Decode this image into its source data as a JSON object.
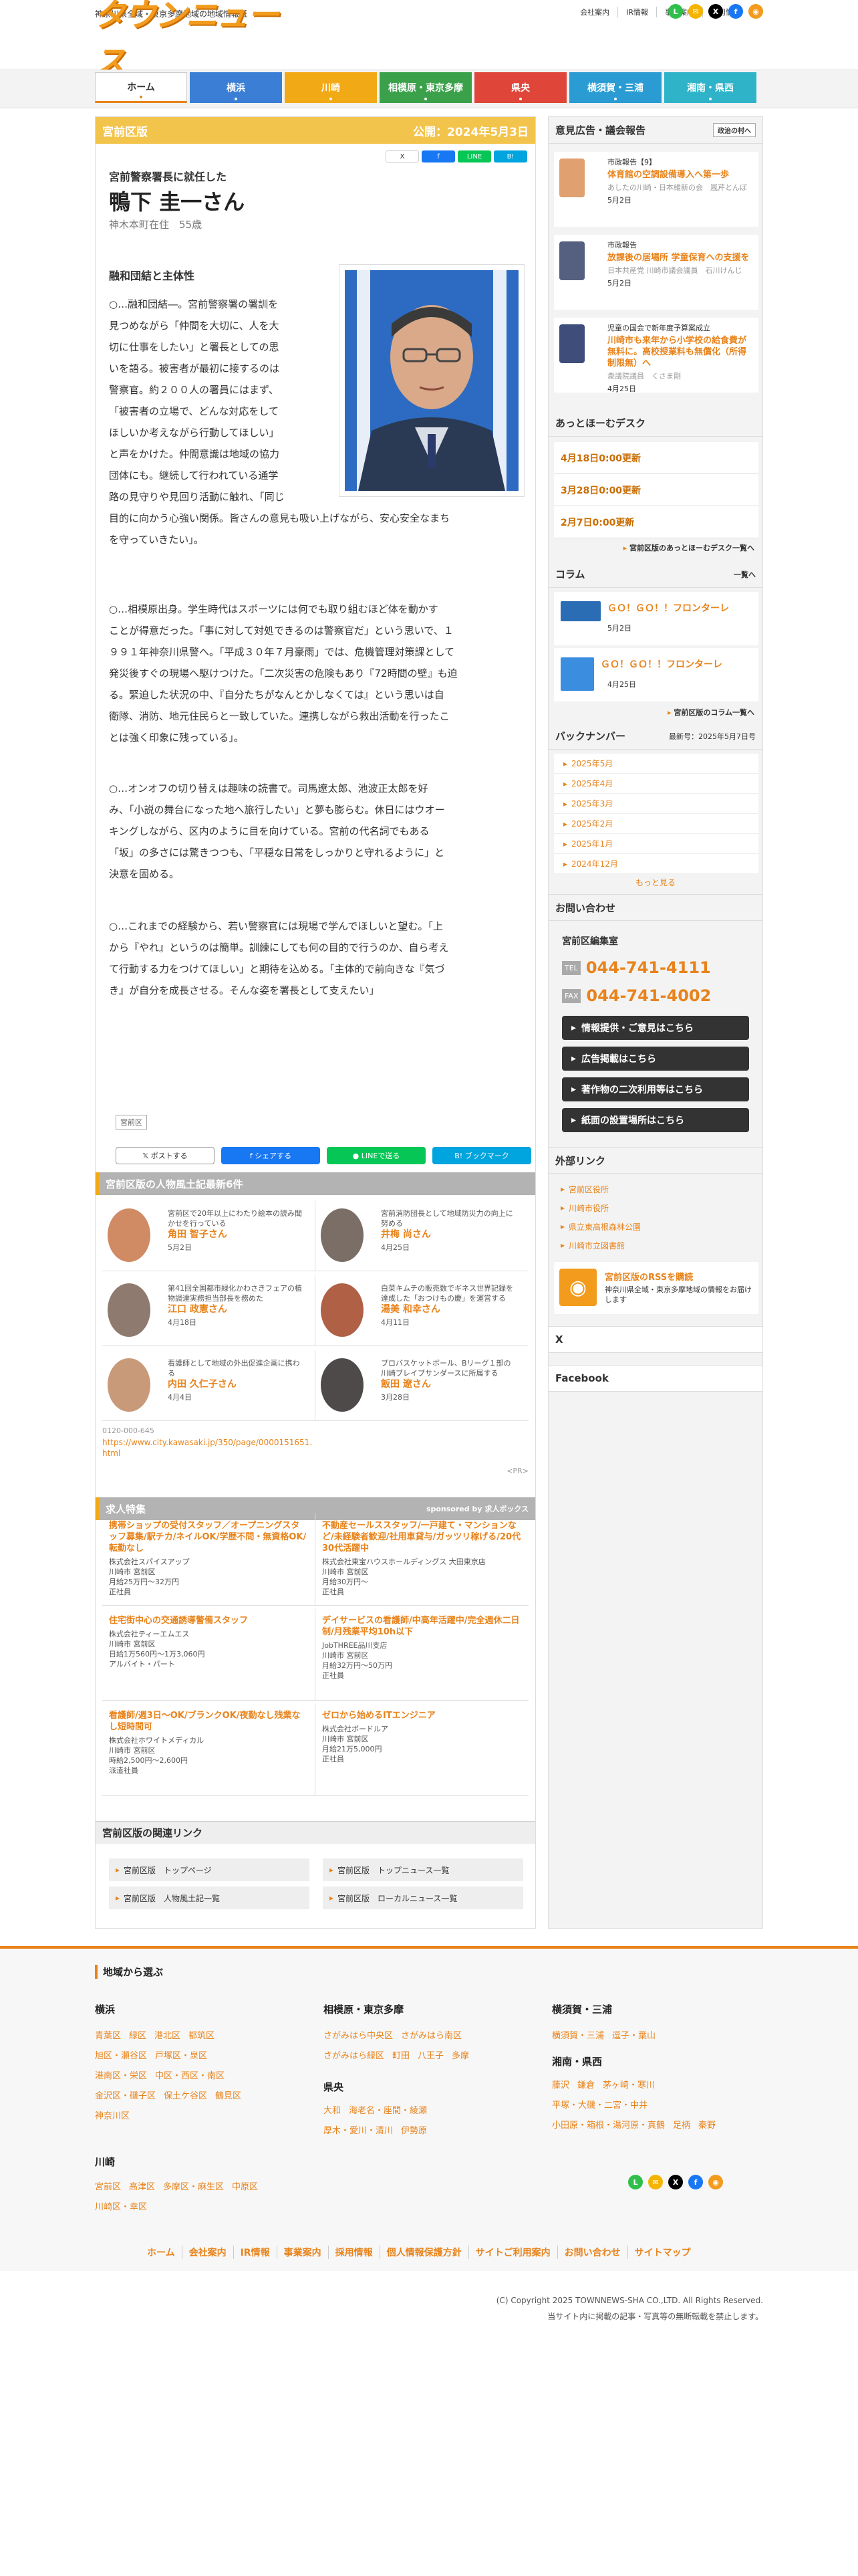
{
  "header": {
    "tagline": "神奈川県全域・東京多摩地域の地域情報紙",
    "logo": "タウンニュース",
    "top_links": [
      "会社案内",
      "IR情報",
      "事業案内",
      "採用情報"
    ]
  },
  "nav": [
    {
      "label": "ホーム",
      "color": "#ffffff"
    },
    {
      "label": "横浜",
      "color": "#3a7fd5"
    },
    {
      "label": "川崎",
      "color": "#f2a916"
    },
    {
      "label": "相模原・東京多摩",
      "color": "#3aa14a"
    },
    {
      "label": "県央",
      "color": "#e0453a"
    },
    {
      "label": "横須賀・三浦",
      "color": "#2b9bd3"
    },
    {
      "label": "湘南・県西",
      "color": "#2fb3c9"
    }
  ],
  "article": {
    "section": "宮前区版",
    "published": "公開：2024年5月3日",
    "small_share": [
      "X",
      "f",
      "LINE",
      "B!"
    ],
    "subtitle": "宮前警察署長に就任した",
    "name": "鴨下 圭一さん",
    "profile": "神木本町在住　55歳",
    "heading": "融和団結と主体性",
    "p1": [
      "○…融和団結―。宮前警察署の署訓を",
      "見つめながら「仲間を大切に、人を大",
      "切に仕事をしたい」と署長としての思",
      "いを語る。被害者が最初に接するのは",
      "警察官。約２００人の署員にはまず、",
      "「被害者の立場で、どんな対応をして",
      "ほしいか考えながら行動してほしい」",
      "と声をかけた。仲間意識は地域の協力",
      "団体にも。継続して行われている通学",
      "路の見守りや見回り活動に触れ、「同じ",
      "目的に向かう心強い関係。皆さんの意見も吸い上げながら、安心安全なまち",
      "を守っていきたい」。"
    ],
    "p2": [
      "○…相模原出身。学生時代はスポーツには何でも取り組むほど体を動かす",
      "ことが得意だった。「事に対して対処できるのは警察官だ」という思いで、１",
      "９９１年神奈川県警へ。「平成３０年７月豪雨」では、危機管理対策課として",
      "発災後すぐの現場へ駆けつけた。「二次災害の危険もあり『72時間の壁』も迫",
      "る。緊迫した状況の中、『自分たちがなんとかしなくては』という思いは自",
      "衛隊、消防、地元住民らと一致していた。連携しながら救出活動を行ったこ",
      "とは強く印象に残っている」。"
    ],
    "p3": [
      "○…オンオフの切り替えは趣味の読書で。司馬遼太郎、池波正太郎を好",
      "み、「小説の舞台になった地へ旅行したい」と夢も膨らむ。休日にはウオー",
      "キングしながら、区内のように目を向けている。宮前の代名詞でもある",
      "「坂」の多さには驚きつつも、「平穏な日常をしっかりと守れるように」と",
      "決意を固める。"
    ],
    "p4": [
      "○…これまでの経験から、若い警察官には現場で学んでほしいと望む。「上",
      "から『やれ』というのは簡単。訓練にしても何の目的で行うのか、自ら考え",
      "て行動する力をつけてほしい」と期待を込める。「主体的で前向きな『気づ",
      "き』が自分を成長させる。そんな姿を署長として支えたい」"
    ],
    "tag": "宮前区",
    "share": [
      "ポストする",
      "シェアする",
      "LINEで送る",
      "ブックマーク"
    ]
  },
  "people": {
    "title": "宮前区版の人物風土記最新6件",
    "items": [
      {
        "desc": "宮前区で20年以上にわたり絵本の読み聞かせを行っている",
        "name": "角田 智子さん",
        "date": "5月2日",
        "bg": "#d08a64"
      },
      {
        "desc": "宮前消防団長として地域防災力の向上に努める",
        "name": "井梅 尚さん",
        "date": "4月25日",
        "bg": "#7a6e66"
      },
      {
        "desc": "第41回全国都市緑化かわさきフェアの植物調達実務担当部長を務めた",
        "name": "江口 政憲さん",
        "date": "4月18日",
        "bg": "#8e7a6e"
      },
      {
        "desc": "白菜キムチの販売数でギネス世界記録を達成した「おつけもの慶」を運営する",
        "name": "湯美 和幸さん",
        "date": "4月11日",
        "bg": "#b06044"
      },
      {
        "desc": "看護師として地域の外出促進企画に携わる",
        "name": "内田 久仁子さん",
        "date": "4月4日",
        "bg": "#c89a7a"
      },
      {
        "desc": "プロバスケットボール、Bリーグ１部の川崎ブレイブサンダースに所属する",
        "name": "飯田 遼さん",
        "date": "3月28日",
        "bg": "#4e4a4a"
      }
    ],
    "phone": "0120-000-645",
    "url": "https://www.city.kawasaki.jp/350/page/0000151651.html",
    "pr": "<PR>"
  },
  "jobs": {
    "title": "求人特集",
    "sponsor": "sponsored by 求人ボックス",
    "items": [
      {
        "title": "携帯ショップの受付スタッフ／オープニングスタッフ募集/駅チカ/ネイルOK/学歴不問・無資格OK/転勤なし",
        "company": "株式会社スパイスアップ",
        "place": "川崎市 宮前区",
        "pay": "月給25万円～32万円",
        "type": "正社員"
      },
      {
        "title": "不動産セールススタッフ/一戸建て・マンションなど/未経験者歓迎/社用車貸与/ガッツリ稼げる/20代30代活躍中",
        "company": "株式会社東宝ハウスホールディングス 大田東京店",
        "place": "川崎市 宮前区",
        "pay": "月給30万円～",
        "type": "正社員"
      },
      {
        "title": "住宅街中心の交通誘導警備スタッフ",
        "company": "株式会社ティーエムエス",
        "place": "川崎市 宮前区",
        "pay": "日給1万560円～1万3,060円",
        "type": "アルバイト・パート"
      },
      {
        "title": "デイサービスの看護師/中高年活躍中/完全週休二日制/月残業平均10h以下",
        "company": "JobTHREE品川支店",
        "place": "川崎市 宮前区",
        "pay": "月給32万円～50万円",
        "type": "正社員"
      },
      {
        "title": "看護師/週3日～OK/ブランクOK/夜勤なし残業なし短時間可",
        "company": "株式会社ホワイトメディカル",
        "place": "川崎市 宮前区",
        "pay": "時給2,500円～2,600円",
        "type": "派遣社員"
      },
      {
        "title": "ゼロから始めるITエンジニア",
        "company": "株式会社ボードルア",
        "place": "川崎市 宮前区",
        "pay": "月給21万5,000円",
        "type": "正社員"
      }
    ]
  },
  "related": {
    "title": "宮前区版の関連リンク",
    "links": [
      "宮前区版　トップページ",
      "宮前区版　トップニュース一覧",
      "宮前区版　人物風土記一覧",
      "宮前区版　ローカルニュース一覧"
    ]
  },
  "sidebar": {
    "opinion_title": "意見広告・議会報告",
    "opinion_btn": "政治の村へ",
    "opinion": [
      {
        "cat": "市政報告【9】",
        "title": "体育館の空調設備導入へ第一歩",
        "author": "あしたの川崎・日本維新の会　嵐芹とんぼ",
        "date": "5月2日",
        "bg": "#e0a070"
      },
      {
        "cat": "市政報告",
        "title": "放課後の居場所 学童保育への支援を",
        "author": "日本共産党 川崎市議会議員　石川けんじ",
        "date": "5月2日",
        "bg": "#556080"
      },
      {
        "cat": "児童の国会で新年度予算案成立",
        "title": "川崎市も来年から小学校の給食費が無料に。高校授業料も無償化（所得制限無）へ",
        "author": "衆議院議員　くさま剛",
        "date": "4月25日",
        "bg": "#3e4d7a"
      }
    ],
    "desk_title": "あっとほーむデスク",
    "desk": [
      "4月18日0:00更新",
      "3月28日0:00更新",
      "2月7日0:00更新"
    ],
    "desk_more": "宮前区版のあっとほーむデスク一覧へ",
    "column_title": "コラム",
    "column_more": "一覧へ",
    "columns": [
      {
        "title": "ＧＯ！ＧＯ！！フロンターレ",
        "date": "5月2日",
        "bg": "#2a6db5"
      },
      {
        "title": "ＧＯ！ＧＯ！！フロンターレ",
        "date": "4月25日",
        "bg": "#3b8de0"
      }
    ],
    "column_link": "宮前区版のコラム一覧へ",
    "backnum_title": "バックナンバー",
    "backnum_latest": "最新号：2025年5月7日号",
    "backnum": [
      "2025年5月",
      "2025年4月",
      "2025年3月",
      "2025年2月",
      "2025年1月",
      "2024年12月"
    ],
    "backnum_more": "もっと見る",
    "contact_title": "お問い合わせ",
    "contact_dept": "宮前区編集室",
    "tel": "044-741-4111",
    "fax": "044-741-4002",
    "tel_label": "TEL",
    "fax_label": "FAX",
    "contact_btns": [
      "情報提供・ご意見はこちら",
      "広告掲載はこちら",
      "著作物の二次利用等はこちら",
      "紙面の設置場所はこちら"
    ],
    "ext_title": "外部リンク",
    "ext": [
      "宮前区役所",
      "川崎市役所",
      "県立東高根森林公園",
      "川崎市立図書館"
    ],
    "rss_title": "宮前区版のRSSを購読",
    "rss_desc": "神奈川県全域・東京多摩地域の情報をお届けします",
    "x_title": "X",
    "fb_title": "Facebook"
  },
  "footer": {
    "title": "地域から選ぶ",
    "yokohama": {
      "h": "横浜",
      "l1": [
        "青葉区",
        "緑区",
        "港北区",
        "都筑区"
      ],
      "l2": [
        "旭区・瀬谷区",
        "戸塚区・泉区"
      ],
      "l3": [
        "港南区・栄区",
        "中区・西区・南区"
      ],
      "l4": [
        "金沢区・磯子区",
        "保土ケ谷区",
        "鶴見区"
      ],
      "l5": [
        "神奈川区"
      ]
    },
    "kawasaki": {
      "h": "川崎",
      "l1": [
        "宮前区",
        "高津区",
        "多摩区・麻生区",
        "中原区"
      ],
      "l2": [
        "川崎区・幸区"
      ]
    },
    "sagami": {
      "h": "相模原・東京多摩",
      "l1": [
        "さがみはら中央区",
        "さがみはら南区"
      ],
      "l2": [
        "さがみはら緑区",
        "町田",
        "八王子",
        "多摩"
      ]
    },
    "kenou": {
      "h": "県央",
      "l1": [
        "大和",
        "海老名・座間・綾瀬"
      ],
      "l2": [
        "厚木・愛川・清川",
        "伊勢原"
      ]
    },
    "yokosuka": {
      "h": "横須賀・三浦",
      "l1": [
        "横須賀・三浦",
        "逗子・葉山"
      ]
    },
    "shonan": {
      "h": "湘南・県西",
      "l1": [
        "藤沢",
        "鎌倉",
        "茅ヶ崎・寒川"
      ],
      "l2": [
        "平塚・大磯・二宮・中井"
      ],
      "l3": [
        "小田原・箱根・湯河原・真鶴",
        "足柄",
        "秦野"
      ]
    },
    "links": [
      "ホーム",
      "会社案内",
      "IR情報",
      "事業案内",
      "採用情報",
      "個人情報保護方針",
      "サイトご利用案内",
      "お問い合わせ",
      "サイトマップ"
    ],
    "copyright": "(C) Copyright 2025 TOWNNEWS-SHA CO.,LTD. All Rights Reserved.",
    "notice": "当サイト内に掲載の記事・写真等の無断転載を禁止します。"
  }
}
